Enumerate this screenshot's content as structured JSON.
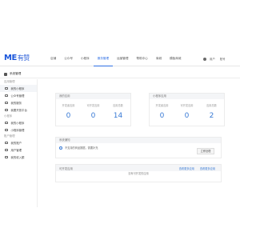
{
  "header": {
    "logo": "ME",
    "logo_cn": "有赞",
    "nav": [
      "店铺",
      "公众号",
      "小程序",
      "服务管理",
      "运营管理",
      "帮助中心",
      "商城",
      "模板商城"
    ],
    "active_nav_index": 3,
    "user_name": "用户",
    "user_mail": "账号"
  },
  "subheader": {
    "title": "系统管理"
  },
  "sidebar": {
    "groups": [
      {
        "title": "应用管理",
        "items": [
          "我的小程序",
          "公众号管理",
          "我的服务",
          "我要开放平台"
        ]
      },
      {
        "title": "小程序",
        "items": [
          "我的小程序",
          "小程序管理"
        ]
      },
      {
        "title": "账户管理",
        "items": [
          "我的账户",
          "用户管理",
          "我的收入额"
        ]
      }
    ],
    "active_item": "我的小程序"
  },
  "stats_left": {
    "title": "我的应用",
    "items": [
      {
        "label": "开发者应用",
        "value": "0"
      },
      {
        "label": "可开发应用",
        "value": "0"
      },
      {
        "label": "应用总数",
        "value": "14"
      }
    ]
  },
  "stats_right": {
    "title": "小程序应用",
    "items": [
      {
        "label": "开发者应用",
        "value": "0"
      },
      {
        "label": "可开发应用",
        "value": "0"
      },
      {
        "label": "应用总数",
        "value": "2"
      }
    ]
  },
  "notice": {
    "title": "系统通知",
    "text": "不支持的商品数据，需要补充",
    "button": "立即处理"
  },
  "table": {
    "title": "可开发应用",
    "link1": "查看更多应用",
    "link2": "查看更多应用",
    "empty": "没有可开发的应用"
  }
}
